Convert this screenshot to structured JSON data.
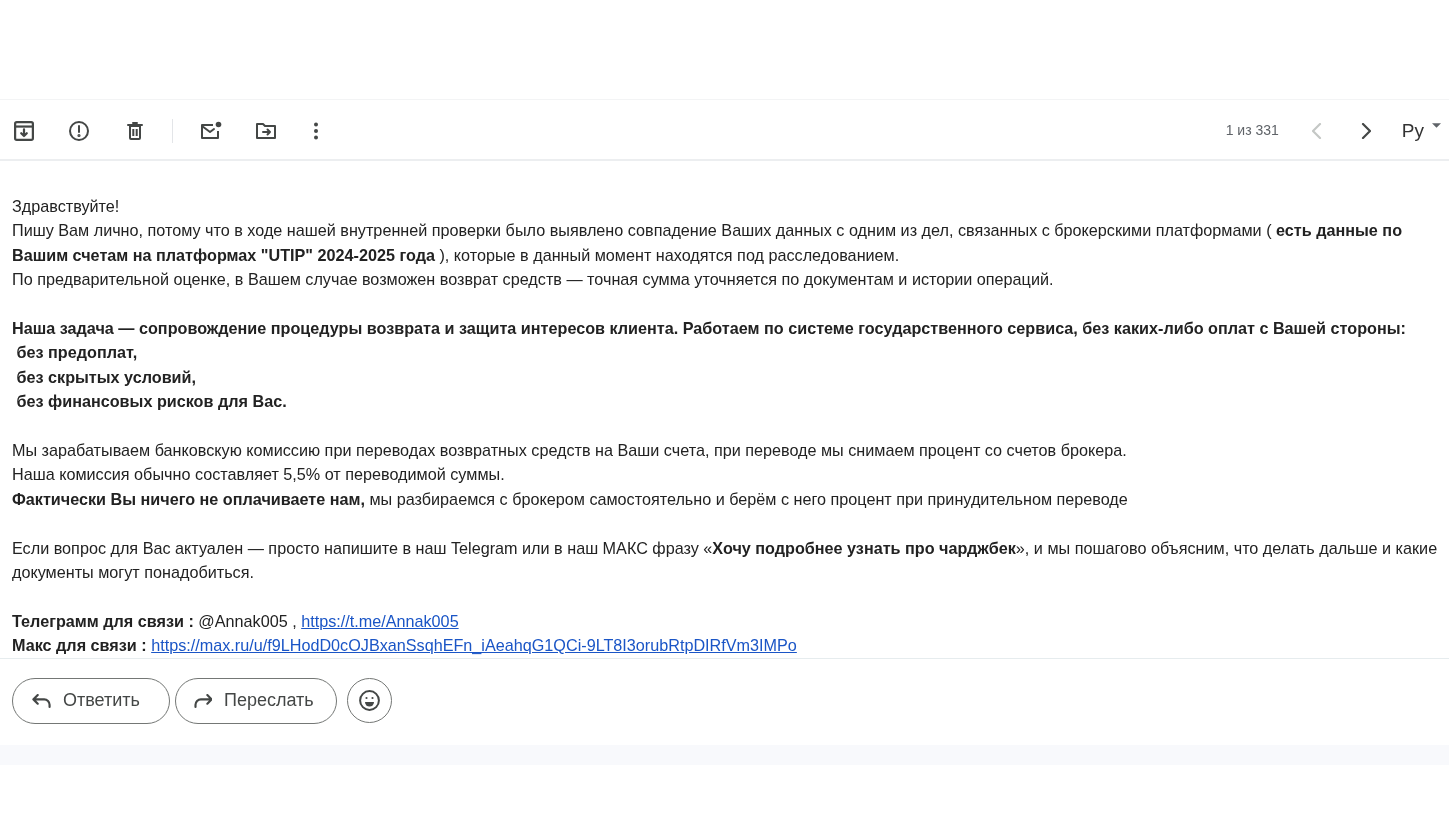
{
  "toolbar": {
    "pagination": {
      "text": "1 из 331",
      "prev": {
        "disabled": true
      },
      "next": {
        "disabled": false
      }
    },
    "input_tool": {
      "label": "Ру"
    }
  },
  "message": {
    "blocks": [
      {
        "lines": [
          {
            "kind": "text",
            "text": "Здравствуйте!",
            "bold": false
          },
          {
            "kind": "text",
            "text": "Пишу Вам лично, потому что в ходе нашей внутренней проверки было выявлено совпадение Ваших данных с одним из дел, связанных с брокерскими платформами ( **есть данные по Вашим счетам на платформах \"UTIP\" 2024-2025 года** ), которые в данный момент находятся под расследованием.",
            "bold": false
          },
          {
            "kind": "text",
            "text": "По предварительной оценке, в Вашем случае возможен возврат средств — точная сумма уточняется по документам и истории операций.",
            "bold": false
          }
        ]
      },
      {
        "lines": [
          {
            "kind": "text",
            "text": "Наша задача — сопровождение процедуры возврата и защита интересов клиента. Работаем по системе государственного сервиса, без каких-либо оплат с Вашей стороны:",
            "bold": true
          },
          {
            "kind": "text",
            "text": " без предоплат,",
            "bold": true
          },
          {
            "kind": "text",
            "text": " без скрытых условий,",
            "bold": true
          },
          {
            "kind": "text",
            "text": " без финансовых рисков для Вас.",
            "bold": true
          }
        ]
      },
      {
        "lines": [
          {
            "kind": "text",
            "text": "Мы зарабатываем банковскую комиссию при переводах возвратных средств на Ваши счета, при переводе мы снимаем процент со счетов брокера.",
            "bold": false
          },
          {
            "kind": "text",
            "text": "Наша комиссия обычно составляет 5,5% от переводимой суммы.",
            "bold": false
          },
          {
            "kind": "text",
            "text": "**Фактически Вы ничего не оплачиваете нам,** мы разбираемся с брокером самостоятельно и берём с него процент при принудительном переводе",
            "bold": false
          }
        ]
      },
      {
        "lines": [
          {
            "kind": "text",
            "text": "Если вопрос для Вас актуален — просто напишите в наш Telegram или в наш МАКС фразу «**Хочу подробнее узнать про чарджбек**», и мы пошагово объясним, что делать дальше и какие документы могут понадобиться.",
            "bold": false
          }
        ]
      },
      {
        "lines": [
          {
            "kind": "contact",
            "label": "Телеграмм для связи :",
            "handle": "@Annak005 ,",
            "link": "https://t.me/Annak005"
          },
          {
            "kind": "contact",
            "label": "Макс для связи :",
            "link": "https://max.ru/u/f9LHodD0cOJBxanSsqhEFn_iAeahqG1QCi-9LT8I3orubRtpDIRfVm3IMPo"
          }
        ]
      }
    ]
  },
  "actions": [
    {
      "kind": "reply",
      "label": "Ответить"
    },
    {
      "kind": "forward",
      "label": "Переслать"
    },
    {
      "kind": "emoji"
    }
  ]
}
